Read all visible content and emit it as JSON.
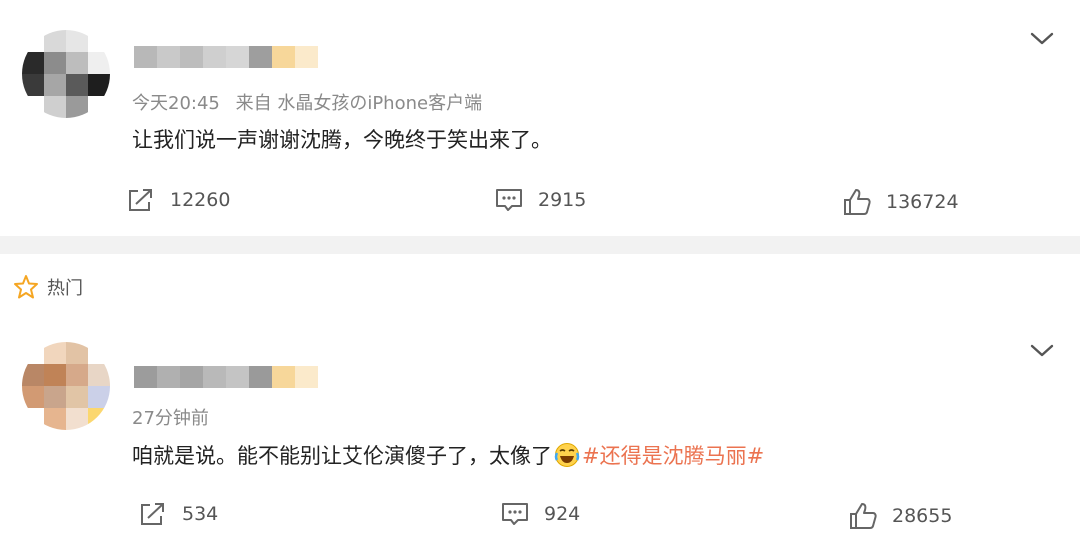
{
  "comments": [
    {
      "meta_time": "今天20:45",
      "meta_source": "来自 水晶女孩のiPhone客户端",
      "text": "让我们说一声谢谢沈腾，今晚终于笑出来了。",
      "actions": {
        "repost_count": "12260",
        "comment_count": "2915",
        "like_count": "136724"
      }
    },
    {
      "meta_time": "27分钟前",
      "text": "咱就是说。能不能别让艾伦演傻子了，太像了",
      "hashtag": "#还得是沈腾马丽#",
      "actions": {
        "repost_count": "534",
        "comment_count": "924",
        "like_count": "28655"
      }
    }
  ],
  "section": {
    "hot_label": "热门"
  },
  "icons": {
    "expand": "chevron-down-icon",
    "repost": "share-icon",
    "comment": "comment-icon",
    "like": "thumbs-up-icon",
    "hot": "star-icon",
    "emoji": "laughing-crying-emoji-icon"
  },
  "colors": {
    "hashtag": "#eb7350",
    "meta": "#8a8a8a",
    "divider": "#f2f2f2",
    "hot_star": "#f5a623"
  }
}
